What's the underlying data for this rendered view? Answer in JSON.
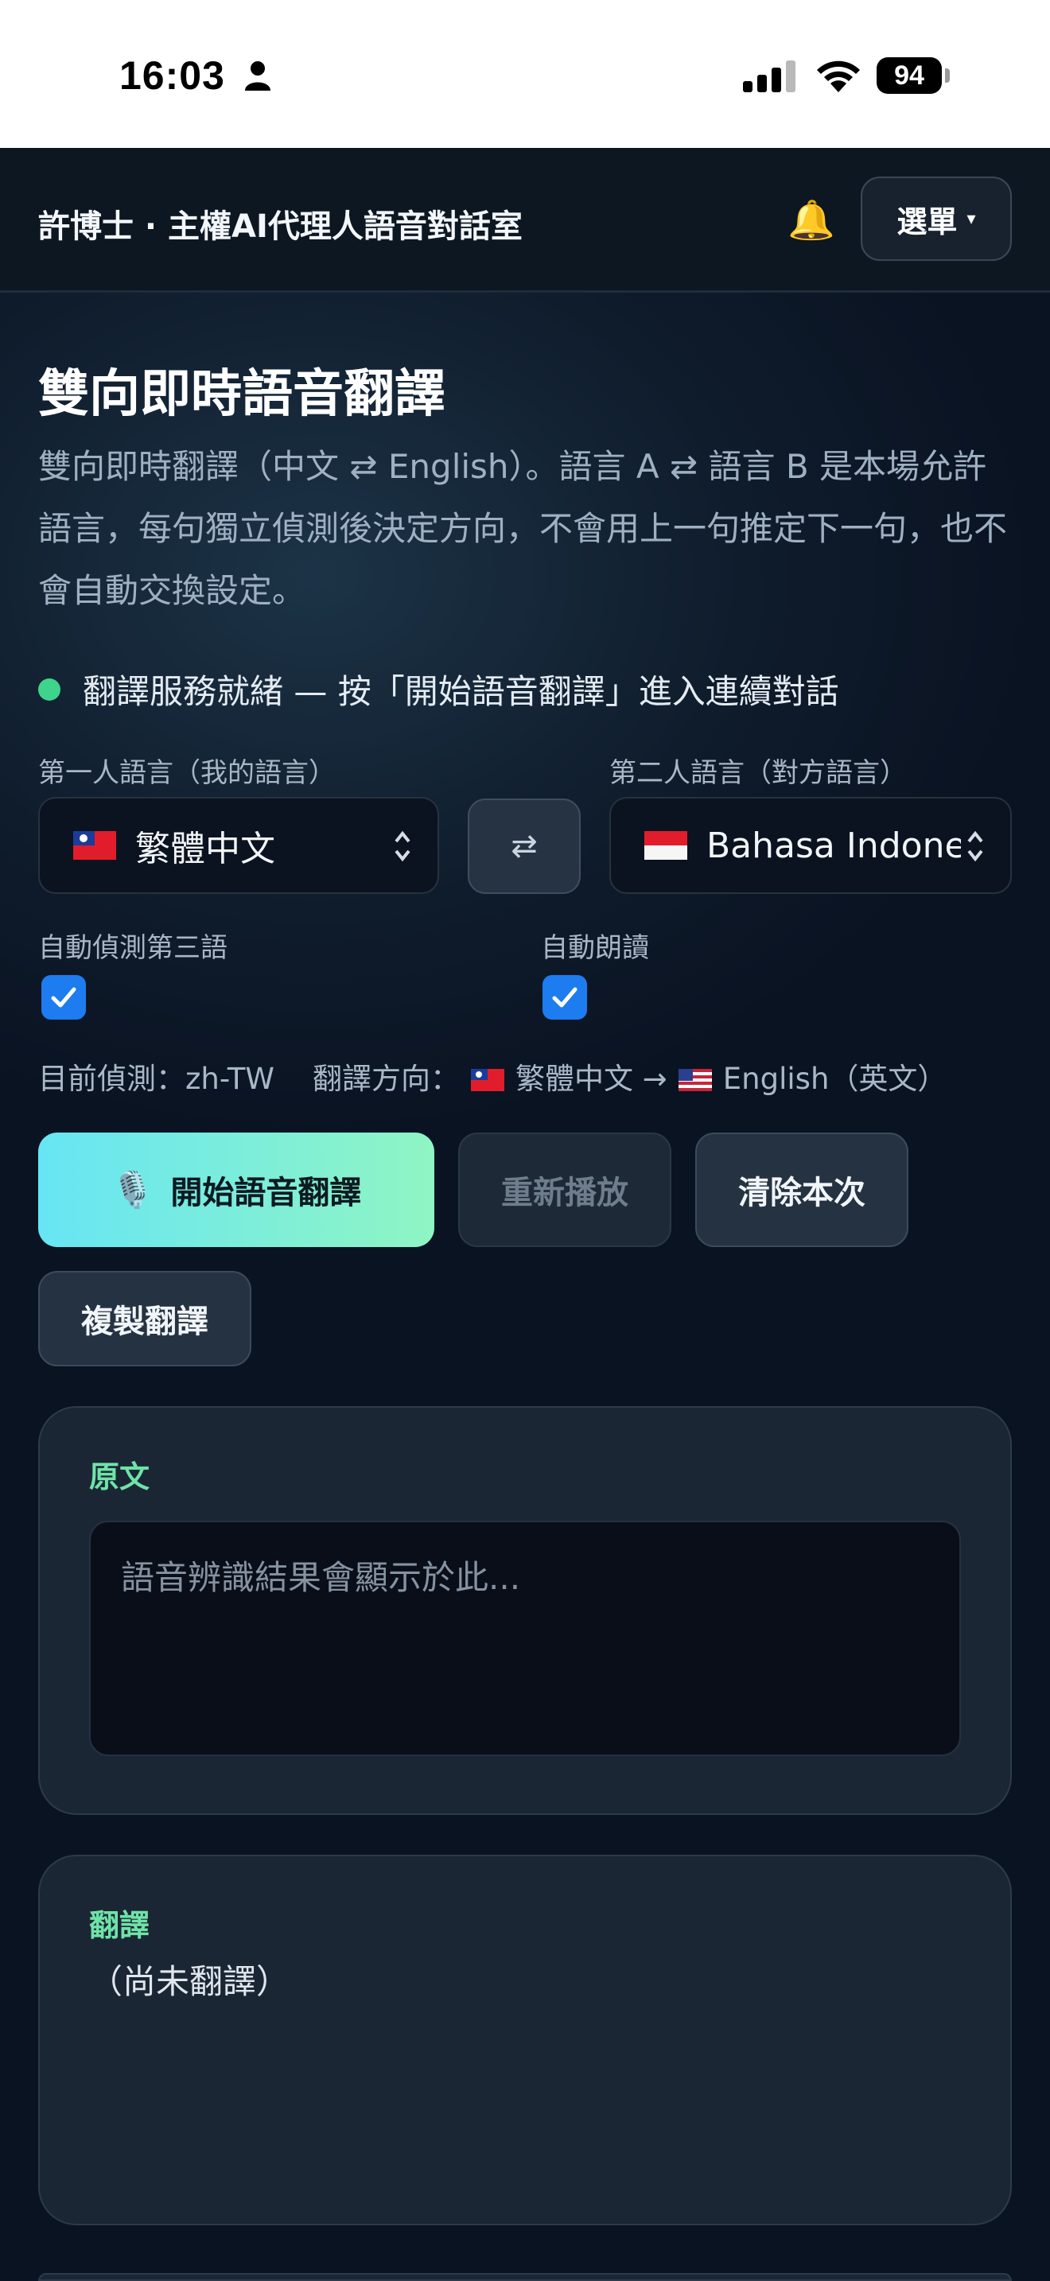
{
  "status_bar": {
    "time": "16:03",
    "battery": "94"
  },
  "header": {
    "title": "許博士 · 主權AI代理人語音對話室",
    "bell_icon": "🔔",
    "menu_label": "選單",
    "menu_caret": "▾"
  },
  "page": {
    "title": "雙向即時語音翻譯",
    "description": "雙向即時翻譯（中文 ⇄ English）。語言 A ⇄ 語言 B 是本場允許語言，每句獨立偵測後決定方向，不會用上一句推定下一句，也不會自動交換設定。",
    "status_text": "翻譯服務就緒 — 按「開始語音翻譯」進入連續對話"
  },
  "languages": {
    "first_label": "第一人語言（我的語言）",
    "first_value": "繁體中文",
    "second_label": "第二人語言（對方語言）",
    "second_value": "Bahasa Indonesia",
    "swap_symbol": "⇄",
    "select_arrows": "⌃⌄"
  },
  "options": {
    "auto_detect_label": "自動偵測第三語",
    "auto_detect_checked": true,
    "auto_read_label": "自動朗讀",
    "auto_read_checked": true
  },
  "detection": {
    "current_prefix": "目前偵測：",
    "current_value": "zh-TW",
    "direction_prefix": "翻譯方向：",
    "direction_from": "繁體中文",
    "direction_arrow": "→",
    "direction_to": "English（英文）"
  },
  "actions": {
    "mic_icon": "🎙️",
    "start_label": "開始語音翻譯",
    "replay_label": "重新播放",
    "clear_label": "清除本次",
    "copy_label": "複製翻譯"
  },
  "source_card": {
    "label": "原文",
    "placeholder": "語音辨識結果會顯示於此..."
  },
  "translation_card": {
    "label": "翻譯",
    "text": "（尚未翻譯）"
  },
  "colors": {
    "accent_green": "#6fe3a8",
    "status_dot": "#3fd48b",
    "checkbox_blue": "#1d7cf0",
    "start_gradient_from": "#67e5f4",
    "start_gradient_to": "#8ff5c3"
  }
}
